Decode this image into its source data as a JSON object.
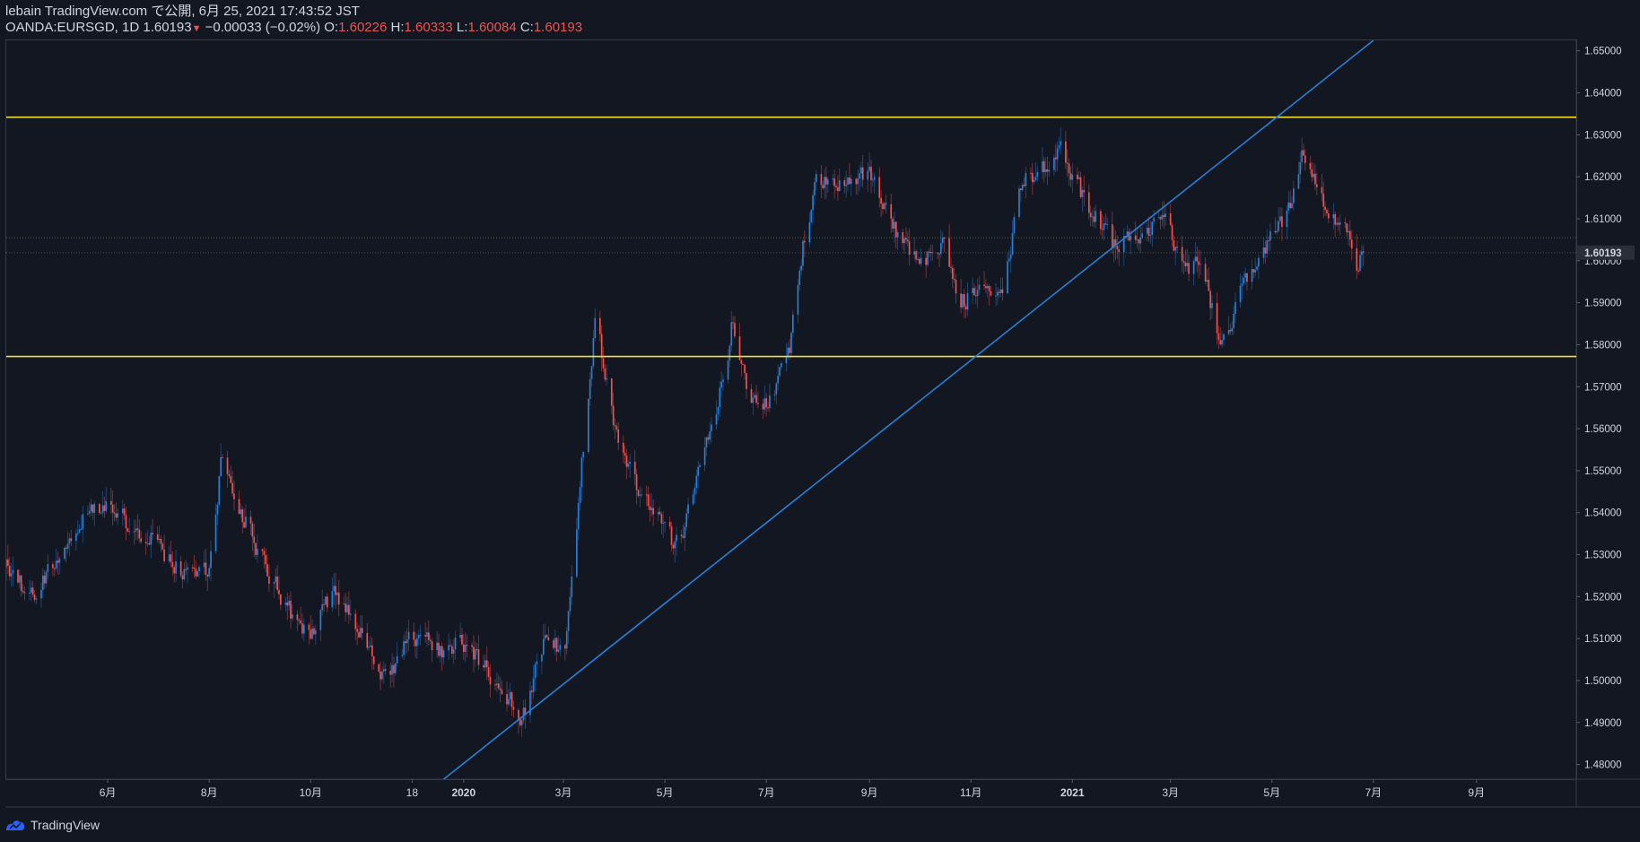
{
  "header": {
    "line1": "lebain TradingView.com で公開, 6月 25, 2021 17:43:52 JST",
    "symbol": "OANDA:EURSGD, 1D 1.60193",
    "arrow": "▼",
    "change": "−0.00033 (−0.02%)",
    "o_label": "O:",
    "o_value": "1.60226",
    "h_label": "H:",
    "h_value": "1.60333",
    "l_label": "L:",
    "l_value": "1.60084",
    "c_label": "C:",
    "c_value": "1.60193"
  },
  "footer": {
    "brand": "TradingView"
  },
  "colors": {
    "up": "#2a7fd6",
    "down": "#ef5350",
    "hline": "#f2e035",
    "trend": "#2a7fd6",
    "bg": "#131722",
    "price_tag": "#d1d4dc"
  },
  "chart_data": {
    "type": "candlestick",
    "instrument": "OANDA:EURSGD",
    "timeframe": "1D",
    "last_price": "1.60193",
    "y_ticks": [
      "1.65000",
      "1.64000",
      "1.63000",
      "1.62000",
      "1.61000",
      "1.60000",
      "1.59000",
      "1.58000",
      "1.57000",
      "1.56000",
      "1.55000",
      "1.54000",
      "1.53000",
      "1.52000",
      "1.51000",
      "1.50000",
      "1.49000",
      "1.48000"
    ],
    "ylim": [
      1.4765,
      1.6525
    ],
    "x_ticks": [
      {
        "label": "6月",
        "date": "2019-06-01"
      },
      {
        "label": "8月",
        "date": "2019-08-01"
      },
      {
        "label": "10月",
        "date": "2019-10-01"
      },
      {
        "label": "18",
        "date": "2019-12-01"
      },
      {
        "label": "2020",
        "date": "2020-01-01"
      },
      {
        "label": "3月",
        "date": "2020-03-01"
      },
      {
        "label": "5月",
        "date": "2020-05-01"
      },
      {
        "label": "7月",
        "date": "2020-07-01"
      },
      {
        "label": "9月",
        "date": "2020-09-01"
      },
      {
        "label": "11月",
        "date": "2020-11-01"
      },
      {
        "label": "2021",
        "date": "2021-01-01"
      },
      {
        "label": "3月",
        "date": "2021-03-01"
      },
      {
        "label": "5月",
        "date": "2021-05-01"
      },
      {
        "label": "7月",
        "date": "2021-07-01"
      },
      {
        "label": "9月",
        "date": "2021-09-01"
      }
    ],
    "xlim": [
      "2019-04-01",
      "2021-10-31"
    ],
    "price_path": [
      [
        "2019-04-01",
        1.527
      ],
      [
        "2019-04-15",
        1.52
      ],
      [
        "2019-05-01",
        1.528
      ],
      [
        "2019-05-15",
        1.538
      ],
      [
        "2019-06-01",
        1.543
      ],
      [
        "2019-06-15",
        1.537
      ],
      [
        "2019-07-01",
        1.532
      ],
      [
        "2019-07-15",
        1.526
      ],
      [
        "2019-08-01",
        1.527
      ],
      [
        "2019-08-08",
        1.552
      ],
      [
        "2019-08-20",
        1.54
      ],
      [
        "2019-09-01",
        1.529
      ],
      [
        "2019-09-20",
        1.515
      ],
      [
        "2019-10-01",
        1.512
      ],
      [
        "2019-10-15",
        1.522
      ],
      [
        "2019-11-01",
        1.51
      ],
      [
        "2019-11-15",
        1.5
      ],
      [
        "2019-12-01",
        1.511
      ],
      [
        "2019-12-20",
        1.507
      ],
      [
        "2020-01-01",
        1.509
      ],
      [
        "2020-01-20",
        1.5
      ],
      [
        "2020-02-05",
        1.491
      ],
      [
        "2020-02-20",
        1.512
      ],
      [
        "2020-03-01",
        1.505
      ],
      [
        "2020-03-10",
        1.545
      ],
      [
        "2020-03-20",
        1.585
      ],
      [
        "2020-04-01",
        1.56
      ],
      [
        "2020-04-15",
        1.545
      ],
      [
        "2020-05-01",
        1.535
      ],
      [
        "2020-05-10",
        1.532
      ],
      [
        "2020-05-20",
        1.548
      ],
      [
        "2020-06-01",
        1.564
      ],
      [
        "2020-06-10",
        1.585
      ],
      [
        "2020-06-20",
        1.567
      ],
      [
        "2020-07-01",
        1.565
      ],
      [
        "2020-07-15",
        1.58
      ],
      [
        "2020-07-25",
        1.61
      ],
      [
        "2020-08-01",
        1.62
      ],
      [
        "2020-08-15",
        1.618
      ],
      [
        "2020-09-01",
        1.621
      ],
      [
        "2020-09-15",
        1.608
      ],
      [
        "2020-10-01",
        1.598
      ],
      [
        "2020-10-15",
        1.605
      ],
      [
        "2020-10-25",
        1.59
      ],
      [
        "2020-11-10",
        1.593
      ],
      [
        "2020-11-20",
        1.593
      ],
      [
        "2020-12-01",
        1.619
      ],
      [
        "2020-12-15",
        1.622
      ],
      [
        "2020-12-25",
        1.627
      ],
      [
        "2021-01-10",
        1.613
      ],
      [
        "2021-01-25",
        1.604
      ],
      [
        "2021-02-10",
        1.605
      ],
      [
        "2021-02-25",
        1.61
      ],
      [
        "2021-03-10",
        1.598
      ],
      [
        "2021-03-20",
        1.599
      ],
      [
        "2021-03-31",
        1.578
      ],
      [
        "2021-04-10",
        1.591
      ],
      [
        "2021-04-25",
        1.603
      ],
      [
        "2021-05-10",
        1.611
      ],
      [
        "2021-05-20",
        1.626
      ],
      [
        "2021-06-01",
        1.613
      ],
      [
        "2021-06-15",
        1.608
      ],
      [
        "2021-06-20",
        1.598
      ],
      [
        "2021-06-25",
        1.60193
      ]
    ],
    "annotations": [
      {
        "type": "horizontal_line",
        "price": 1.6342
      },
      {
        "type": "horizontal_line",
        "price": 1.5772
      },
      {
        "type": "trend_line",
        "points": [
          [
            "2019-12-20",
            1.4765
          ],
          [
            "2021-07-01",
            1.6525
          ]
        ]
      },
      {
        "type": "price_line",
        "price": 1.6055
      },
      {
        "type": "price_line",
        "price": 1.6019
      }
    ]
  }
}
